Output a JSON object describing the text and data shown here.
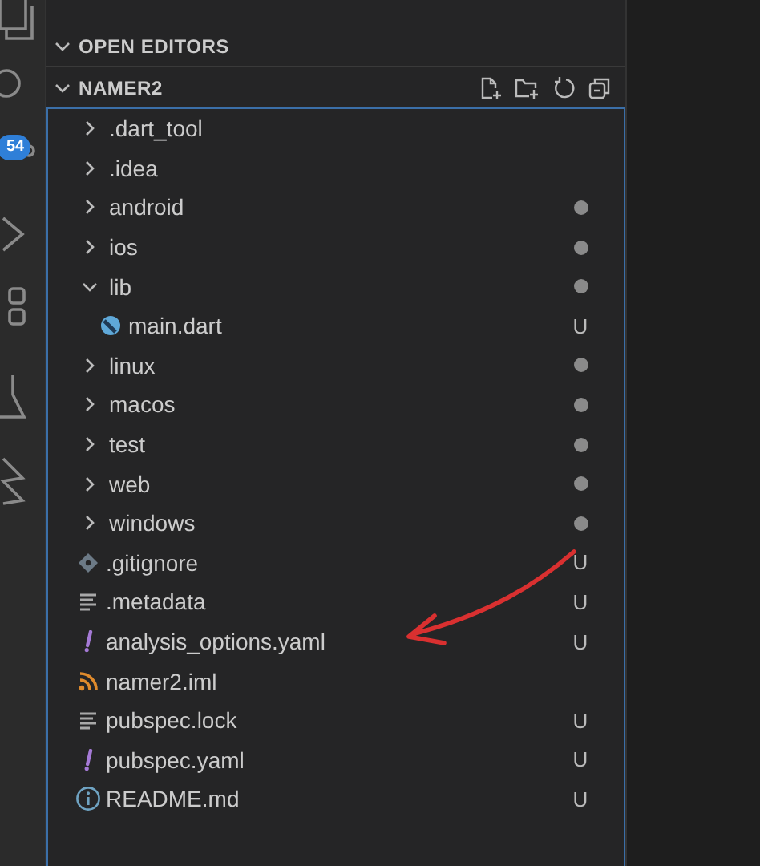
{
  "activity_bar": {
    "badge": "54"
  },
  "sections": [
    {
      "title": "OPEN EDITORS",
      "expanded": true,
      "actions": false
    },
    {
      "title": "NAMER2",
      "expanded": true,
      "actions": true
    }
  ],
  "tree": [
    {
      "name": ".dart_tool",
      "kind": "folder",
      "expanded": false,
      "dirty": false
    },
    {
      "name": ".idea",
      "kind": "folder",
      "expanded": false,
      "dirty": false
    },
    {
      "name": "android",
      "kind": "folder",
      "expanded": false,
      "dirty": true
    },
    {
      "name": "ios",
      "kind": "folder",
      "expanded": false,
      "dirty": true
    },
    {
      "name": "lib",
      "kind": "folder",
      "expanded": true,
      "dirty": true,
      "children": [
        {
          "name": "main.dart",
          "kind": "dart",
          "status": "U"
        }
      ]
    },
    {
      "name": "linux",
      "kind": "folder",
      "expanded": false,
      "dirty": true
    },
    {
      "name": "macos",
      "kind": "folder",
      "expanded": false,
      "dirty": true
    },
    {
      "name": "test",
      "kind": "folder",
      "expanded": false,
      "dirty": true
    },
    {
      "name": "web",
      "kind": "folder",
      "expanded": false,
      "dirty": true
    },
    {
      "name": "windows",
      "kind": "folder",
      "expanded": false,
      "dirty": true
    },
    {
      "name": ".gitignore",
      "kind": "git",
      "status": "U"
    },
    {
      "name": ".metadata",
      "kind": "text",
      "status": "U"
    },
    {
      "name": "analysis_options.yaml",
      "kind": "yaml",
      "status": "U"
    },
    {
      "name": "namer2.iml",
      "kind": "feed"
    },
    {
      "name": "pubspec.lock",
      "kind": "text",
      "status": "U"
    },
    {
      "name": "pubspec.yaml",
      "kind": "yaml",
      "status": "U"
    },
    {
      "name": "README.md",
      "kind": "info",
      "status": "U"
    }
  ]
}
